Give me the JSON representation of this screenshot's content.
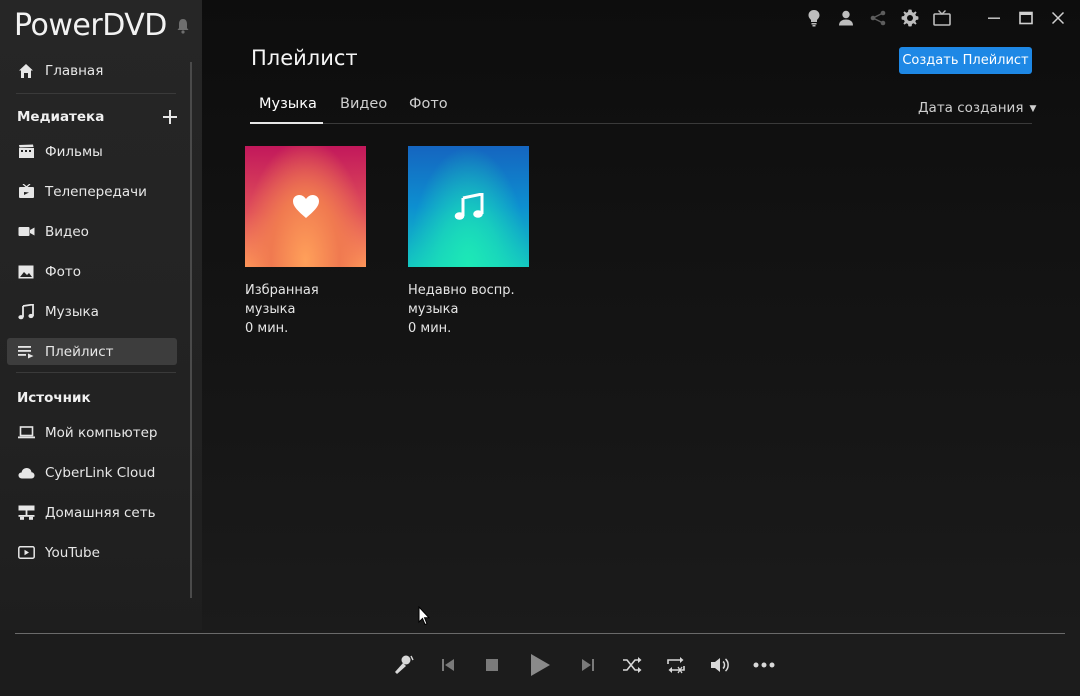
{
  "app": {
    "title": "PowerDVD"
  },
  "sidebar": {
    "home": {
      "label": "Главная",
      "icon": "home-icon"
    },
    "library": {
      "title": "Медиатека",
      "items": [
        {
          "label": "Фильмы",
          "icon": "film-icon"
        },
        {
          "label": "Телепередачи",
          "icon": "tv-show-icon"
        },
        {
          "label": "Видео",
          "icon": "video-camera-icon"
        },
        {
          "label": "Фото",
          "icon": "photo-icon"
        },
        {
          "label": "Музыка",
          "icon": "music-note-icon"
        },
        {
          "label": "Плейлист",
          "icon": "playlist-icon",
          "active": true
        }
      ]
    },
    "source": {
      "title": "Источник",
      "items": [
        {
          "label": "Мой компьютер",
          "icon": "laptop-icon"
        },
        {
          "label": "CyberLink Cloud",
          "icon": "cloud-icon"
        },
        {
          "label": "Домашняя сеть",
          "icon": "network-icon"
        },
        {
          "label": "YouTube",
          "icon": "youtube-icon"
        }
      ]
    }
  },
  "main": {
    "title": "Плейлист",
    "create_button": "Создать Плейлист",
    "tabs": [
      {
        "label": "Музыка",
        "active": true
      },
      {
        "label": "Видео"
      },
      {
        "label": "Фото"
      }
    ],
    "sort": {
      "label": "Дата создания"
    },
    "playlists": [
      {
        "name": "Избранная музыка",
        "duration": "0 мин.",
        "icon": "heart-icon"
      },
      {
        "name": "Недавно воспр. музыка",
        "duration": "0 мин.",
        "icon": "music-note-icon"
      }
    ]
  },
  "colors": {
    "accent": "#1e88e5",
    "active_item": "#3d3d3d",
    "favorite_gradient": [
      "#c2185b",
      "#ff9a5a"
    ],
    "recent_gradient": [
      "#1565c0",
      "#1de9b6"
    ]
  }
}
